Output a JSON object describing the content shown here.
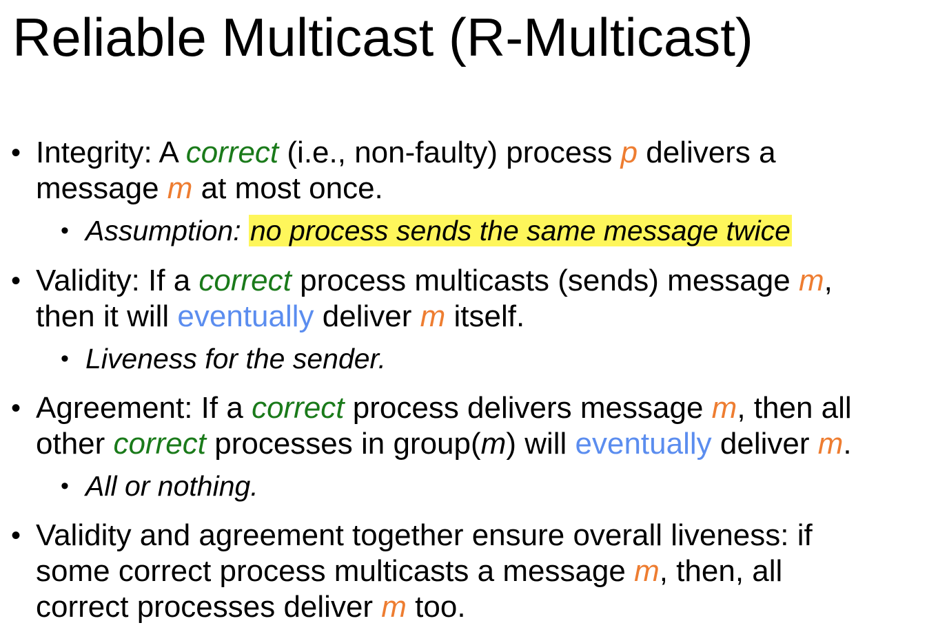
{
  "title": "Reliable Multicast (R-Multicast)",
  "colors": {
    "correct": "#1a7a1a",
    "variable": "#ee7d31",
    "eventually": "#5b8def",
    "highlight": "#fef65b"
  },
  "bullets": [
    {
      "line1": [
        "Integrity: A ",
        "correct",
        " (i.e., non-faulty) process ",
        "p",
        " delivers a"
      ],
      "line2": [
        "message ",
        "m",
        " at most once."
      ],
      "sub": [
        "Assumption: ",
        "no process sends the same message twice"
      ]
    },
    {
      "line1": [
        "Validity: If a ",
        "correct",
        " process multicasts (sends) message ",
        "m",
        ","
      ],
      "line2": [
        "then it will ",
        "eventually",
        " deliver ",
        "m",
        " itself."
      ],
      "sub": [
        "Liveness for the sender."
      ]
    },
    {
      "line1": [
        "Agreement: If a ",
        "correct",
        " process delivers message ",
        "m",
        ", then all"
      ],
      "line2": [
        "other ",
        "correct",
        " processes in group(",
        "m",
        ") will ",
        "eventually",
        " deliver ",
        "m",
        "."
      ],
      "sub": [
        "All or nothing."
      ]
    },
    {
      "line1": [
        "Validity and agreement together ensure overall liveness: if"
      ],
      "line2": [
        "some correct process multicasts a message ",
        "m",
        ", then, all"
      ],
      "line3": [
        "correct processes deliver ",
        "m",
        " too."
      ]
    }
  ]
}
